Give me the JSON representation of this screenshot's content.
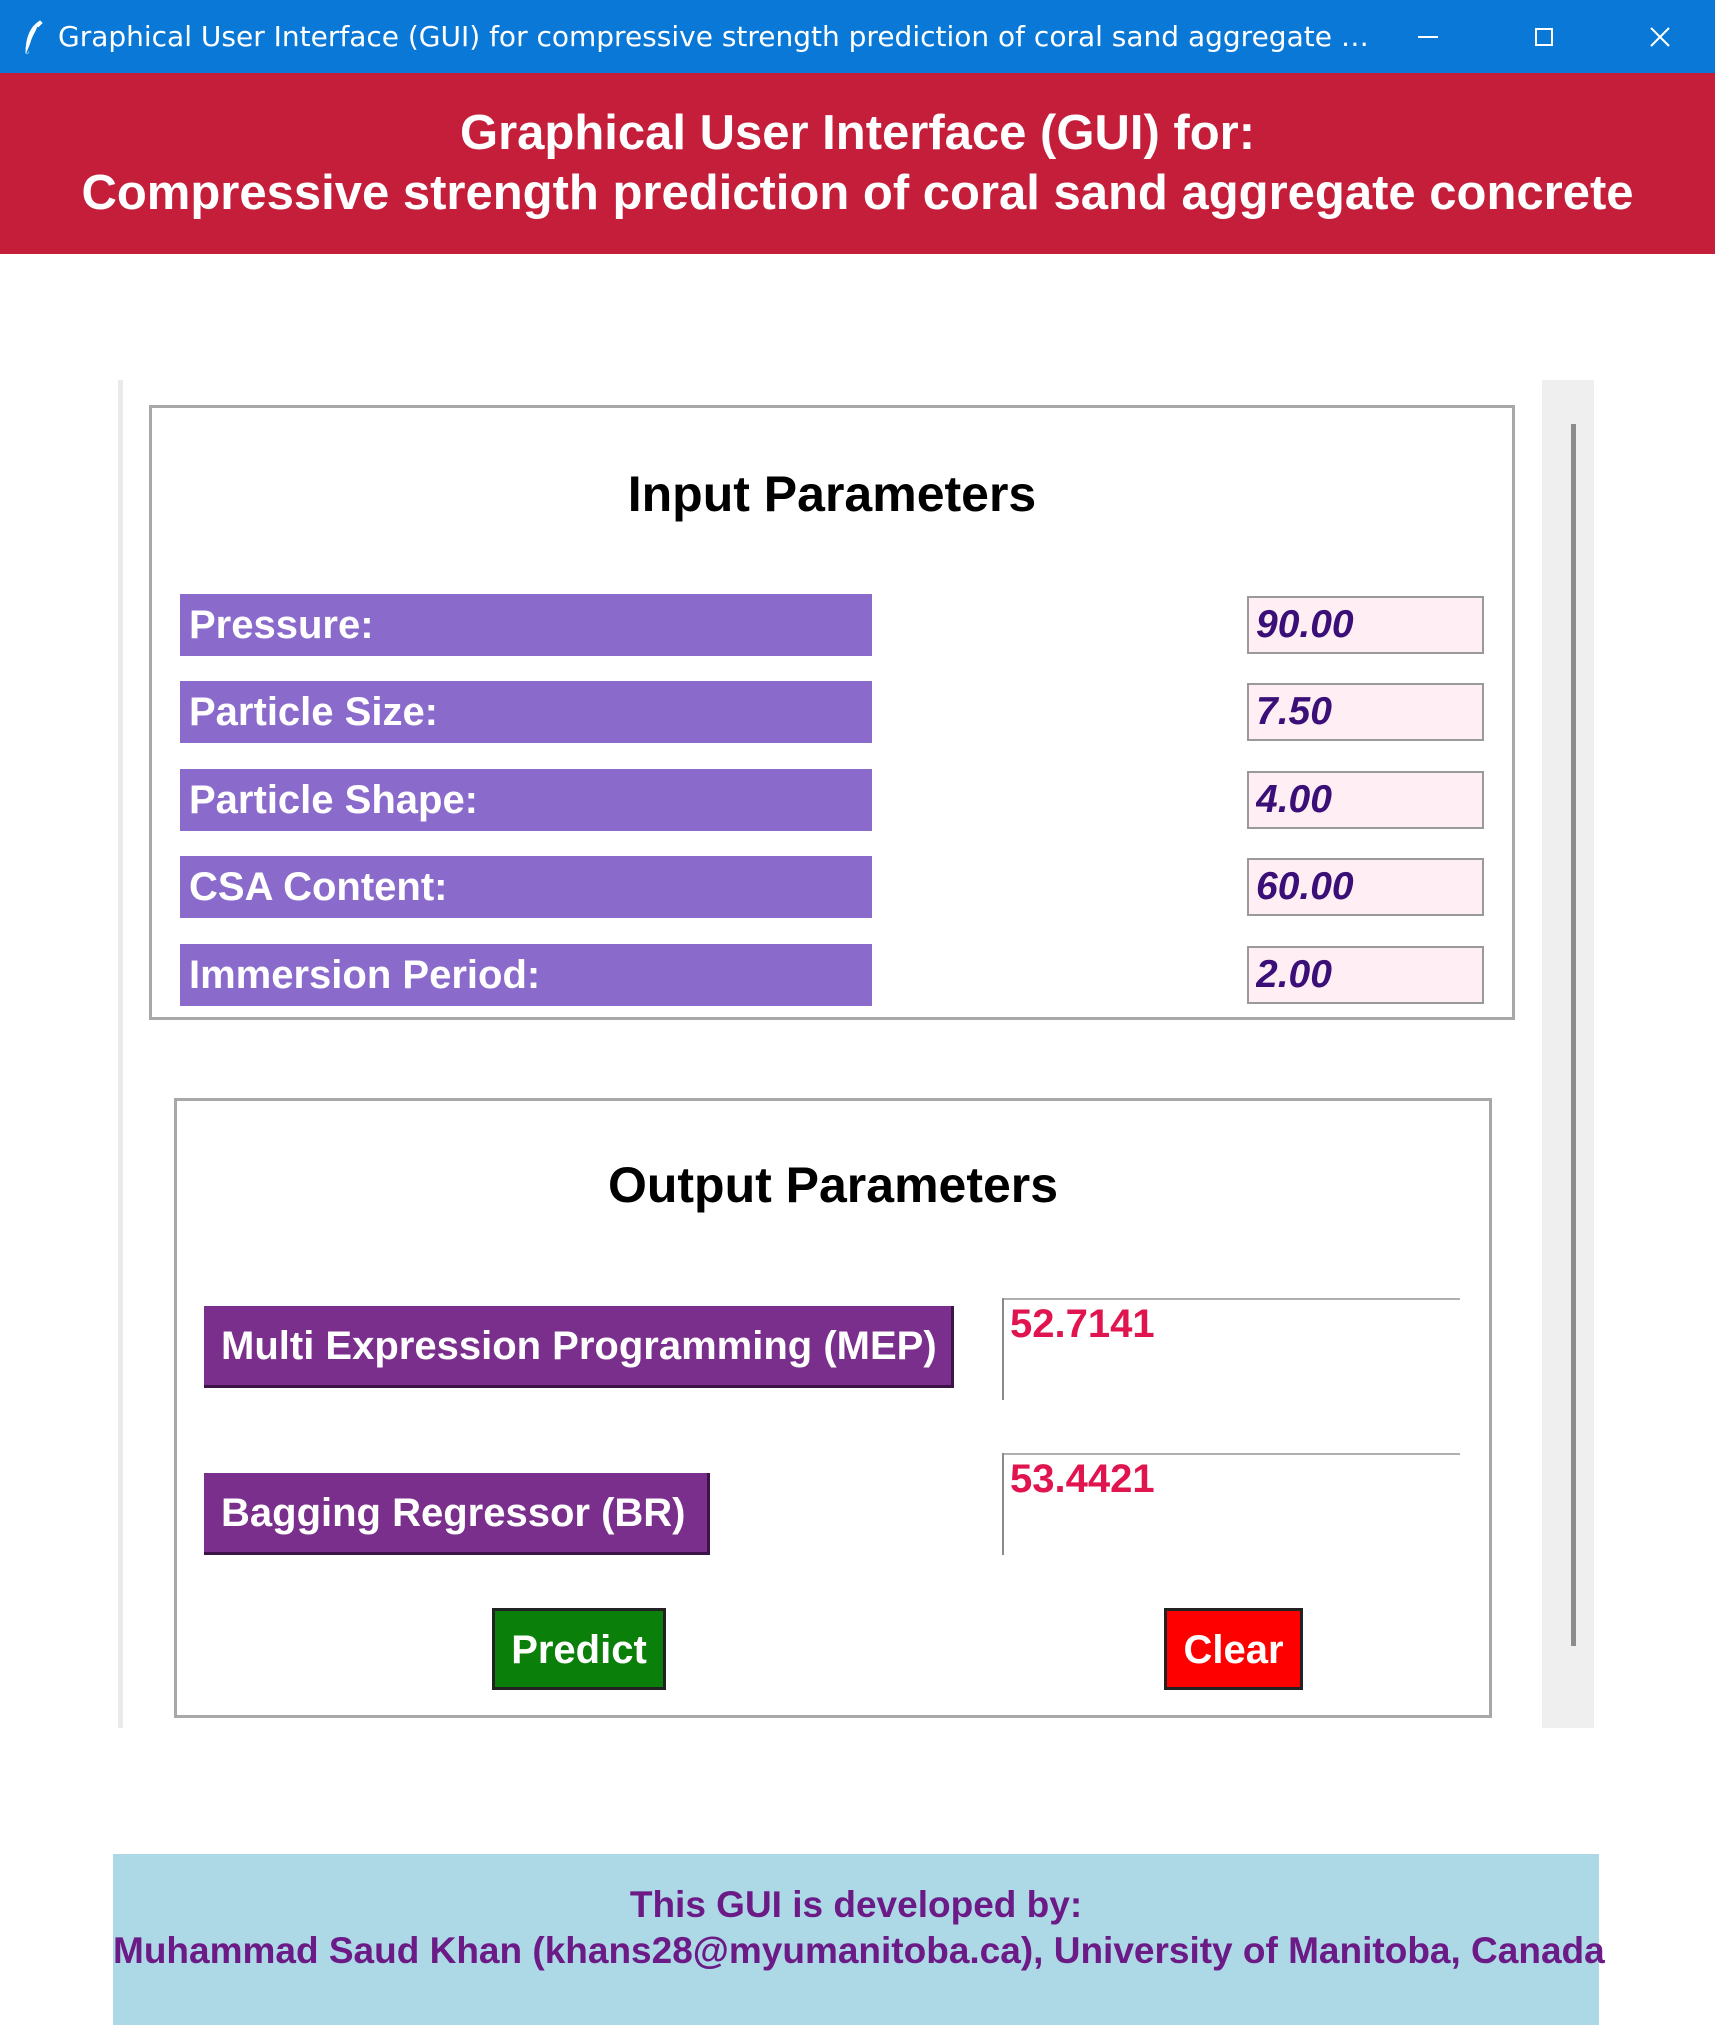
{
  "window": {
    "title": "Graphical User Interface (GUI) for compressive strength prediction of coral sand aggregate concr...",
    "icons": {
      "app": "feather-icon",
      "minimize": "minimize-icon",
      "maximize": "maximize-icon",
      "close": "close-icon"
    }
  },
  "header": {
    "line1": "Graphical User Interface (GUI) for:",
    "line2": "Compressive strength prediction of coral sand aggregate concrete"
  },
  "input_panel": {
    "title": "Input Parameters",
    "params": [
      {
        "label": "Pressure:",
        "value": "90.00"
      },
      {
        "label": "Particle Size:",
        "value": "7.50"
      },
      {
        "label": "Particle Shape:",
        "value": "4.00"
      },
      {
        "label": "CSA Content:",
        "value": "60.00"
      },
      {
        "label": "Immersion Period:",
        "value": "2.00"
      }
    ]
  },
  "output_panel": {
    "title": "Output Parameters",
    "models": [
      {
        "label": "Multi Expression Programming (MEP)",
        "value": "52.7141"
      },
      {
        "label": "Bagging Regressor (BR)",
        "value": "53.4421"
      }
    ],
    "predict_label": "Predict",
    "clear_label": "Clear"
  },
  "footer": {
    "line1": "This GUI is developed by:",
    "line2": "Muhammad Saud Khan (khans28@myumanitoba.ca), University of Manitoba, Canada"
  },
  "colors": {
    "titlebar": "#0a78d6",
    "header_bg": "#c41e3a",
    "param_label_bg": "#8a6bcc",
    "param_field_bg": "#ffeef4",
    "model_label_bg": "#7a2f8d",
    "result_text": "#e0144f",
    "predict_bg": "#0a7f0a",
    "clear_bg": "#ff0000",
    "footer_bg": "#add8e6",
    "footer_text": "#6b1a86"
  }
}
